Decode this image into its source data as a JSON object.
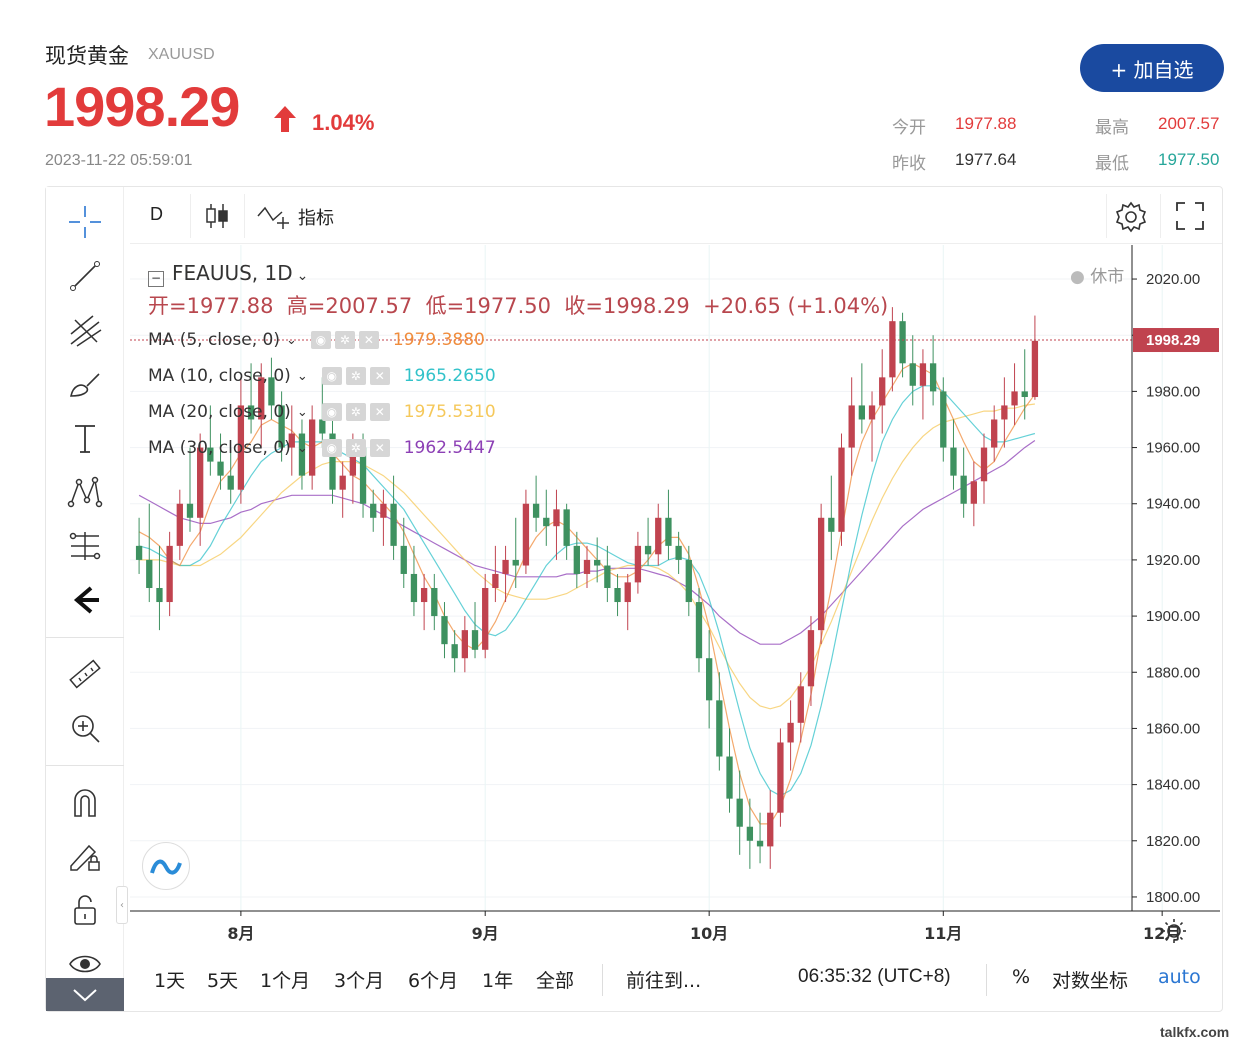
{
  "header": {
    "name": "现货黄金",
    "code": "XAUUSD",
    "price": "1998.29",
    "change_pct": "1.04%",
    "timestamp": "2023-11-22 05:59:01",
    "add_button": "+ 加自选",
    "stats": {
      "open_label": "今开",
      "open": "1977.88",
      "high_label": "最高",
      "high": "2007.57",
      "prev_label": "昨收",
      "prev": "1977.64",
      "low_label": "最低",
      "low": "1977.50"
    }
  },
  "colors": {
    "up": "#c0434f",
    "down": "#3e9160",
    "accent": "#1a4aa0",
    "ma5": "#f08c3c",
    "ma10": "#31c2c9",
    "ma20": "#f5c85a",
    "ma30": "#8c3fb5",
    "low_text": "#26a69a"
  },
  "toolbar": {
    "interval": "D",
    "indicators": "指标"
  },
  "legend": {
    "symbol": "FEAUUS, 1D",
    "ohlc": "开=1977.88  高=2007.57  低=1977.50  收=1998.29  +20.65 (+1.04%)",
    "status": "休市",
    "ma": [
      {
        "label": "MA (5, close, 0)",
        "value": "1979.3880"
      },
      {
        "label": "MA (10, close, 0)",
        "value": "1965.2650"
      },
      {
        "label": "MA (20, close, 0)",
        "value": "1975.5310"
      },
      {
        "label": "MA (30, close, 0)",
        "value": "1962.5447"
      }
    ]
  },
  "chart_data": {
    "type": "candlestick",
    "x_ticks": [
      "8月",
      "9月",
      "10月",
      "11月",
      "12月"
    ],
    "y_ticks": [
      2020,
      2000,
      1980,
      1960,
      1940,
      1920,
      1900,
      1880,
      1860,
      1840,
      1820,
      1800
    ],
    "ylim": [
      1795,
      2025
    ],
    "last_price_label": "1998.29",
    "candles": [
      [
        1925,
        1935,
        1915,
        1920
      ],
      [
        1920,
        1940,
        1905,
        1910
      ],
      [
        1910,
        1925,
        1895,
        1905
      ],
      [
        1905,
        1930,
        1900,
        1925
      ],
      [
        1925,
        1945,
        1920,
        1940
      ],
      [
        1940,
        1960,
        1930,
        1935
      ],
      [
        1935,
        1965,
        1925,
        1960
      ],
      [
        1960,
        1975,
        1950,
        1955
      ],
      [
        1955,
        1965,
        1945,
        1950
      ],
      [
        1950,
        1960,
        1940,
        1945
      ],
      [
        1945,
        1985,
        1940,
        1975
      ],
      [
        1975,
        1990,
        1965,
        1970
      ],
      [
        1970,
        1990,
        1960,
        1985
      ],
      [
        1985,
        1992,
        1970,
        1975
      ],
      [
        1975,
        1980,
        1955,
        1960
      ],
      [
        1960,
        1975,
        1950,
        1965
      ],
      [
        1965,
        1970,
        1945,
        1950
      ],
      [
        1950,
        1975,
        1945,
        1970
      ],
      [
        1970,
        1985,
        1960,
        1965
      ],
      [
        1965,
        1970,
        1940,
        1945
      ],
      [
        1945,
        1955,
        1935,
        1950
      ],
      [
        1950,
        1965,
        1940,
        1960
      ],
      [
        1960,
        1965,
        1935,
        1940
      ],
      [
        1940,
        1945,
        1930,
        1935
      ],
      [
        1935,
        1945,
        1925,
        1940
      ],
      [
        1940,
        1950,
        1920,
        1925
      ],
      [
        1925,
        1935,
        1910,
        1915
      ],
      [
        1915,
        1925,
        1900,
        1905
      ],
      [
        1905,
        1915,
        1895,
        1910
      ],
      [
        1910,
        1915,
        1895,
        1900
      ],
      [
        1900,
        1905,
        1885,
        1890
      ],
      [
        1890,
        1895,
        1880,
        1885
      ],
      [
        1885,
        1900,
        1880,
        1895
      ],
      [
        1895,
        1905,
        1885,
        1888
      ],
      [
        1888,
        1915,
        1885,
        1910
      ],
      [
        1910,
        1925,
        1905,
        1915
      ],
      [
        1915,
        1925,
        1905,
        1920
      ],
      [
        1920,
        1935,
        1910,
        1918
      ],
      [
        1918,
        1945,
        1915,
        1940
      ],
      [
        1940,
        1950,
        1930,
        1935
      ],
      [
        1935,
        1945,
        1925,
        1932
      ],
      [
        1932,
        1945,
        1920,
        1938
      ],
      [
        1938,
        1940,
        1920,
        1925
      ],
      [
        1925,
        1930,
        1910,
        1915
      ],
      [
        1915,
        1925,
        1910,
        1920
      ],
      [
        1920,
        1928,
        1912,
        1918
      ],
      [
        1918,
        1925,
        1905,
        1910
      ],
      [
        1910,
        1915,
        1900,
        1905
      ],
      [
        1905,
        1915,
        1895,
        1912
      ],
      [
        1912,
        1930,
        1908,
        1925
      ],
      [
        1925,
        1935,
        1918,
        1922
      ],
      [
        1922,
        1940,
        1918,
        1935
      ],
      [
        1935,
        1945,
        1920,
        1925
      ],
      [
        1925,
        1930,
        1915,
        1920
      ],
      [
        1920,
        1925,
        1900,
        1905
      ],
      [
        1905,
        1910,
        1880,
        1885
      ],
      [
        1885,
        1895,
        1860,
        1870
      ],
      [
        1870,
        1880,
        1845,
        1850
      ],
      [
        1850,
        1860,
        1830,
        1835
      ],
      [
        1835,
        1845,
        1815,
        1825
      ],
      [
        1825,
        1835,
        1810,
        1820
      ],
      [
        1820,
        1830,
        1812,
        1818
      ],
      [
        1818,
        1838,
        1810,
        1830
      ],
      [
        1830,
        1860,
        1825,
        1855
      ],
      [
        1855,
        1870,
        1845,
        1862
      ],
      [
        1862,
        1880,
        1855,
        1875
      ],
      [
        1875,
        1900,
        1868,
        1895
      ],
      [
        1895,
        1940,
        1890,
        1935
      ],
      [
        1935,
        1950,
        1920,
        1930
      ],
      [
        1930,
        1965,
        1925,
        1960
      ],
      [
        1960,
        1985,
        1950,
        1975
      ],
      [
        1975,
        1990,
        1965,
        1970
      ],
      [
        1970,
        1980,
        1955,
        1975
      ],
      [
        1975,
        1995,
        1965,
        1985
      ],
      [
        1985,
        2010,
        1980,
        2005
      ],
      [
        2005,
        2008,
        1985,
        1990
      ],
      [
        1990,
        2000,
        1975,
        1982
      ],
      [
        1982,
        1995,
        1970,
        1990
      ],
      [
        1990,
        2000,
        1975,
        1980
      ],
      [
        1980,
        1985,
        1955,
        1960
      ],
      [
        1960,
        1970,
        1945,
        1950
      ],
      [
        1950,
        1960,
        1935,
        1940
      ],
      [
        1940,
        1955,
        1932,
        1948
      ],
      [
        1948,
        1965,
        1940,
        1960
      ],
      [
        1960,
        1975,
        1955,
        1970
      ],
      [
        1970,
        1985,
        1960,
        1975
      ],
      [
        1975,
        1990,
        1968,
        1980
      ],
      [
        1980,
        1995,
        1970,
        1978
      ],
      [
        1978,
        2007,
        1977,
        1998
      ]
    ],
    "ma5": [
      1930,
      1928,
      1925,
      1920,
      1918,
      1925,
      1930,
      1940,
      1948,
      1952,
      1958,
      1962,
      1968,
      1970,
      1968,
      1966,
      1962,
      1960,
      1962,
      1958,
      1954,
      1950,
      1948,
      1944,
      1940,
      1936,
      1930,
      1922,
      1914,
      1908,
      1900,
      1894,
      1890,
      1888,
      1892,
      1898,
      1906,
      1914,
      1922,
      1928,
      1932,
      1934,
      1932,
      1928,
      1924,
      1920,
      1916,
      1914,
      1914,
      1916,
      1920,
      1925,
      1928,
      1928,
      1922,
      1910,
      1896,
      1878,
      1860,
      1844,
      1832,
      1826,
      1826,
      1832,
      1842,
      1856,
      1872,
      1892,
      1910,
      1930,
      1950,
      1962,
      1970,
      1976,
      1982,
      1988,
      1990,
      1988,
      1986,
      1978,
      1970,
      1962,
      1955,
      1952,
      1955,
      1962,
      1968,
      1974,
      1979
    ],
    "ma10": [
      1925,
      1924,
      1922,
      1920,
      1918,
      1918,
      1920,
      1925,
      1932,
      1938,
      1944,
      1950,
      1955,
      1958,
      1960,
      1962,
      1962,
      1962,
      1962,
      1960,
      1958,
      1956,
      1954,
      1950,
      1946,
      1942,
      1938,
      1932,
      1926,
      1920,
      1914,
      1908,
      1902,
      1897,
      1894,
      1893,
      1895,
      1900,
      1906,
      1912,
      1918,
      1922,
      1925,
      1926,
      1926,
      1925,
      1923,
      1921,
      1919,
      1918,
      1918,
      1918,
      1920,
      1921,
      1920,
      1915,
      1906,
      1894,
      1880,
      1866,
      1853,
      1844,
      1838,
      1836,
      1838,
      1844,
      1854,
      1868,
      1884,
      1902,
      1920,
      1936,
      1950,
      1962,
      1970,
      1976,
      1980,
      1982,
      1982,
      1980,
      1976,
      1972,
      1968,
      1964,
      1962,
      1962,
      1963,
      1964,
      1965
    ],
    "ma20": [
      1920,
      1920,
      1920,
      1919,
      1918,
      1918,
      1918,
      1920,
      1922,
      1925,
      1928,
      1932,
      1936,
      1940,
      1944,
      1947,
      1950,
      1952,
      1954,
      1955,
      1955,
      1955,
      1954,
      1952,
      1950,
      1947,
      1944,
      1940,
      1936,
      1932,
      1928,
      1924,
      1920,
      1916,
      1913,
      1910,
      1908,
      1907,
      1906,
      1906,
      1906,
      1907,
      1908,
      1910,
      1912,
      1914,
      1916,
      1917,
      1918,
      1918,
      1918,
      1917,
      1915,
      1912,
      1908,
      1902,
      1896,
      1889,
      1882,
      1876,
      1871,
      1868,
      1867,
      1868,
      1871,
      1876,
      1882,
      1890,
      1898,
      1907,
      1916,
      1925,
      1934,
      1942,
      1949,
      1955,
      1960,
      1964,
      1967,
      1969,
      1970,
      1971,
      1972,
      1973,
      1973,
      1974,
      1974,
      1975,
      1975.5
    ],
    "ma30": [
      1943,
      1941,
      1939,
      1937,
      1935,
      1934,
      1933,
      1933,
      1934,
      1935,
      1937,
      1938,
      1940,
      1941,
      1942,
      1943,
      1943,
      1943,
      1943,
      1943,
      1942,
      1941,
      1940,
      1938,
      1936,
      1934,
      1932,
      1930,
      1928,
      1926,
      1924,
      1922,
      1920,
      1918,
      1917,
      1916,
      1915,
      1914,
      1914,
      1914,
      1914,
      1914,
      1915,
      1915,
      1916,
      1916,
      1917,
      1917,
      1917,
      1917,
      1916,
      1915,
      1914,
      1912,
      1910,
      1907,
      1904,
      1900,
      1897,
      1894,
      1892,
      1890,
      1890,
      1890,
      1892,
      1894,
      1897,
      1900,
      1904,
      1908,
      1912,
      1916,
      1920,
      1924,
      1928,
      1932,
      1935,
      1938,
      1940,
      1942,
      1944,
      1946,
      1948,
      1950,
      1952,
      1954,
      1957,
      1960,
      1962.5
    ]
  },
  "bottom": {
    "ranges": [
      "1天",
      "5天",
      "1个月",
      "3个月",
      "6个月",
      "1年",
      "全部"
    ],
    "goto": "前往到...",
    "clock": "06:35:32 (UTC+8)",
    "percent": "%",
    "log": "对数坐标",
    "auto": "auto"
  },
  "watermark": "talkfx.com"
}
